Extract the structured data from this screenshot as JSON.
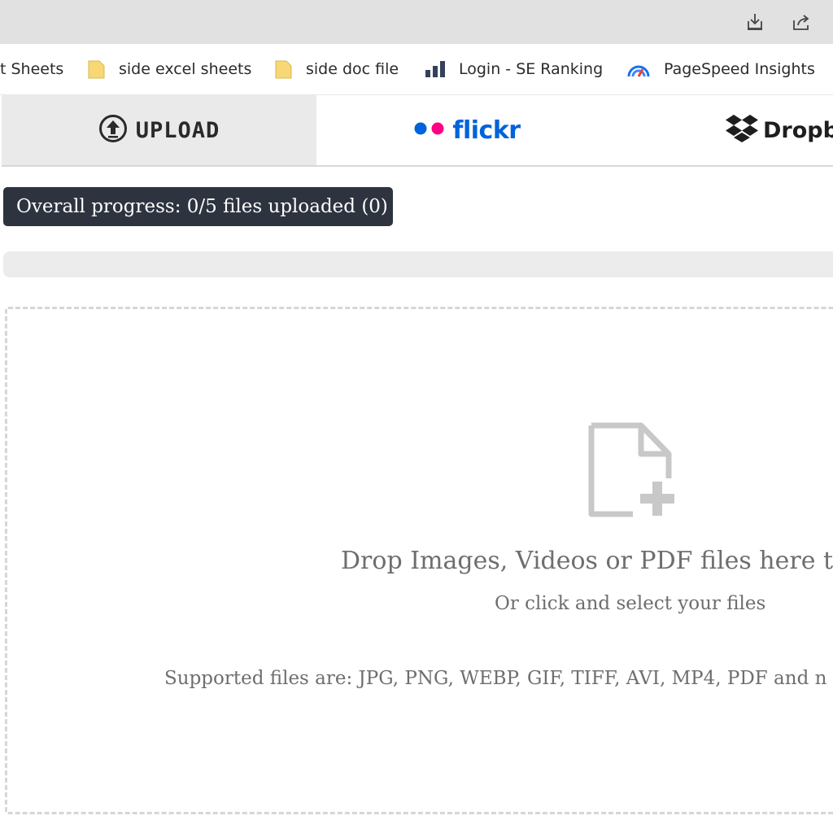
{
  "browser": {
    "toolbar_icons": [
      "download-icon",
      "share-icon"
    ]
  },
  "bookmarks": [
    {
      "label": "t Sheets",
      "icon": "none"
    },
    {
      "label": "side excel sheets",
      "icon": "folder-icon"
    },
    {
      "label": "side doc file",
      "icon": "folder-icon"
    },
    {
      "label": "Login - SE Ranking",
      "icon": "bar-chart-icon"
    },
    {
      "label": "PageSpeed Insights",
      "icon": "pagespeed-icon"
    }
  ],
  "sources": {
    "upload_label": "UPLOAD",
    "flickr_label": "flickr",
    "dropbox_label": "Dropbo"
  },
  "progress": {
    "label": "Overall progress: 0/5 files uploaded (0)",
    "fraction": 0
  },
  "dropzone": {
    "main": "Drop Images, Videos or PDF files here to",
    "sub": "Or click and select your files",
    "supported": "Supported files are: JPG, PNG, WEBP, GIF, TIFF, AVI, MP4, PDF and n"
  },
  "colors": {
    "flickr_blue": "#0063dc",
    "flickr_pink": "#ff0084",
    "folder_yellow": "#f8d775",
    "progress_pill": "#2e3340"
  }
}
